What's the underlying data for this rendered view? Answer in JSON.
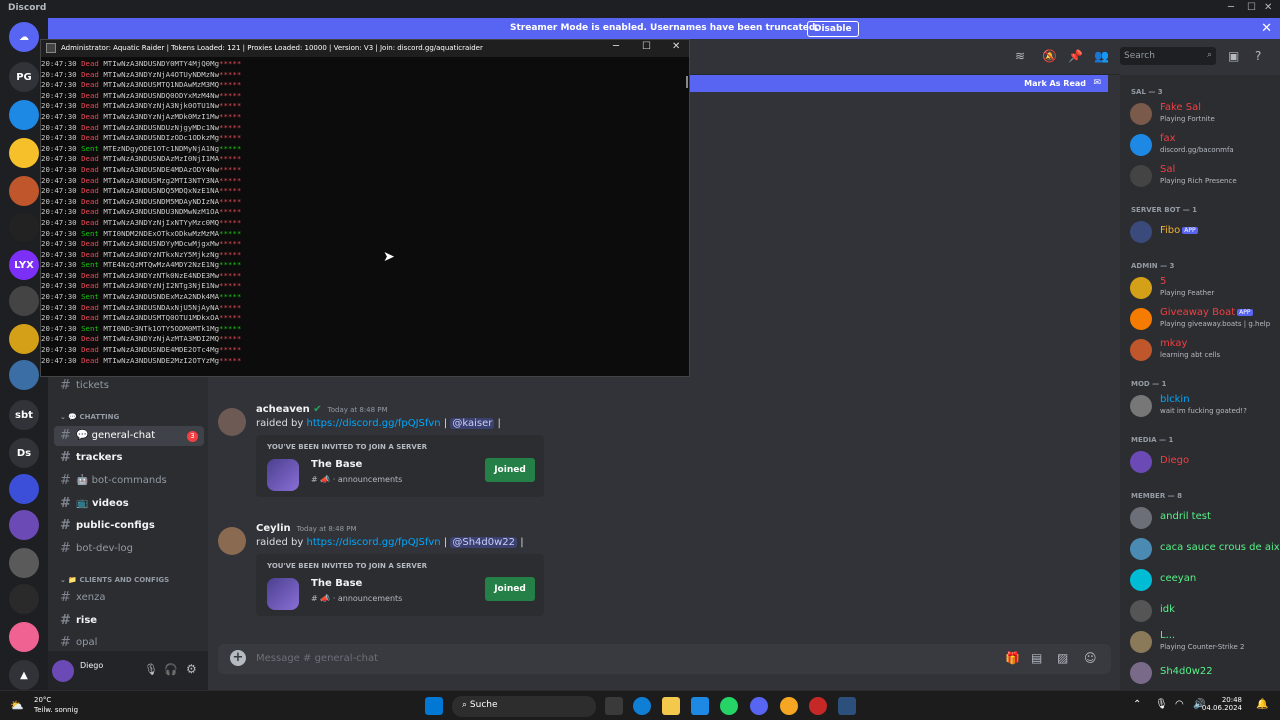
{
  "window": {
    "title": "Discord"
  },
  "banner": {
    "message": "Streamer Mode is enabled. Usernames have been truncated.",
    "disable_label": "Disable"
  },
  "rail": {
    "servers": [
      "PG",
      "sbt",
      "Ds",
      "LYX"
    ]
  },
  "console": {
    "title": "Administrator: Aquatic Raider   |   Tokens Loaded: 121   |   Proxies Loaded: 10000   |   Version: V3   |   Join: discord.gg/aquaticraider",
    "lines": [
      {
        "time": "20:47:30",
        "status": "Dead",
        "token": "MTIwNzA3NDUSNDY0MTY4MjQ0Mg"
      },
      {
        "time": "20:47:30",
        "status": "Dead",
        "token": "MTIwNzA3NDYzNjA4OTUyNDMzNw"
      },
      {
        "time": "20:47:30",
        "status": "Dead",
        "token": "MTIwNzA3NDUSMTQ1NDAwMzM3MQ"
      },
      {
        "time": "20:47:30",
        "status": "Dead",
        "token": "MTIwNzA3NDUSNDQ0ODYxMzM4Nw"
      },
      {
        "time": "20:47:30",
        "status": "Dead",
        "token": "MTIwNzA3NDYzNjA3Njk0OTU1Nw"
      },
      {
        "time": "20:47:30",
        "status": "Dead",
        "token": "MTIwNzA3NDYzNjAzMDk0MzI1Mw"
      },
      {
        "time": "20:47:30",
        "status": "Dead",
        "token": "MTIwNzA3NDUSNDUzNjgyMDc1Nw"
      },
      {
        "time": "20:47:30",
        "status": "Dead",
        "token": "MTIwNzA3NDUSNDIzODc1ODkzMg"
      },
      {
        "time": "20:47:30",
        "status": "Sent",
        "token": "MTEzNDgyODE1OTc1NDMyNjA1Ng"
      },
      {
        "time": "20:47:30",
        "status": "Dead",
        "token": "MTIwNzA3NDUSNDAzMzI0NjI1MA"
      },
      {
        "time": "20:47:30",
        "status": "Dead",
        "token": "MTIwNzA3NDUSNDE4MDAzODY4Nw"
      },
      {
        "time": "20:47:30",
        "status": "Dead",
        "token": "MTIwNzA3NDUSMzg2MTI3NTY3NA"
      },
      {
        "time": "20:47:30",
        "status": "Dead",
        "token": "MTIwNzA3NDUSNDQ5MDQxNzE1NA"
      },
      {
        "time": "20:47:30",
        "status": "Dead",
        "token": "MTIwNzA3NDUSNDM5MDAyNDIzNA"
      },
      {
        "time": "20:47:30",
        "status": "Dead",
        "token": "MTIwNzA3NDUSNDU3NDMwNzM1OA"
      },
      {
        "time": "20:47:30",
        "status": "Dead",
        "token": "MTIwNzA3NDYzNjIxNTYyMzc0MQ"
      },
      {
        "time": "20:47:30",
        "status": "Sent",
        "token": "MTI0NDM2NDExOTkxODkwMzMzMA"
      },
      {
        "time": "20:47:30",
        "status": "Dead",
        "token": "MTIwNzA3NDUSNDYyMDcwMjgxMw"
      },
      {
        "time": "20:47:30",
        "status": "Dead",
        "token": "MTIwNzA3NDYzNTkxNzY5MjkzNg"
      },
      {
        "time": "20:47:30",
        "status": "Sent",
        "token": "MTE4NzQzMTQwMzA4MDY2NzE1Ng"
      },
      {
        "time": "20:47:30",
        "status": "Dead",
        "token": "MTIwNzA3NDYzNTk0NzE4NDE3Mw"
      },
      {
        "time": "20:47:30",
        "status": "Dead",
        "token": "MTIwNzA3NDYzNjI2NTg3NjE1Nw"
      },
      {
        "time": "20:47:30",
        "status": "Sent",
        "token": "MTIwNzA3NDUSNDExMzA2NDk4MA"
      },
      {
        "time": "20:47:30",
        "status": "Dead",
        "token": "MTIwNzA3NDUSNDAxNjU5NjAyNA"
      },
      {
        "time": "20:47:30",
        "status": "Dead",
        "token": "MTIwNzA3NDUSMTQ0OTU1MDkxOA"
      },
      {
        "time": "20:47:30",
        "status": "Sent",
        "token": "MTI0NDc3NTk1OTY5ODM0MTk1Mg"
      },
      {
        "time": "20:47:30",
        "status": "Dead",
        "token": "MTIwNzA3NDYzNjAzMTA3MDI2MQ"
      },
      {
        "time": "20:47:30",
        "status": "Dead",
        "token": "MTIwNzA3NDUSNDE4MDE2OTc4Mg"
      },
      {
        "time": "20:47:30",
        "status": "Dead",
        "token": "MTIwNzA3NDUSNDE2MzI2OTYzMg"
      }
    ]
  },
  "channels": {
    "tickets": "tickets",
    "cat_chatting": "CHATTING",
    "general": "general-chat",
    "general_badge": "3",
    "trackers": "trackers",
    "bot_commands": "bot-commands",
    "videos": "videos",
    "public_configs": "public-configs",
    "bot_dev_log": "bot-dev-log",
    "cat_clients": "CLIENTS AND CONFIGS",
    "xenza": "xenza",
    "rise": "rise",
    "opal": "opal"
  },
  "user": {
    "name": "Diego"
  },
  "header": {
    "search_placeholder": "Search",
    "mark_read": "Mark As Read"
  },
  "messages": [
    {
      "author": "acheaven",
      "time": "Today at 8:48 PM",
      "prefix": "raided by ",
      "link": "https://discord.gg/fpQJSfvn",
      "sep": " | ",
      "mention": "@kaiser",
      "suffix": " |",
      "invite": {
        "label": "YOU'VE BEEN INVITED TO JOIN A SERVER",
        "server": "The Base",
        "channel": "announcements",
        "button": "Joined"
      }
    },
    {
      "author": "Ceylin",
      "time": "Today at 8:48 PM",
      "prefix": "raided by ",
      "link": "https://discord.gg/fpQJSfvn",
      "sep": " | ",
      "mention": "@Sh4d0w22",
      "suffix": " |",
      "invite": {
        "label": "YOU'VE BEEN INVITED TO JOIN A SERVER",
        "server": "The Base",
        "channel": "announcements",
        "button": "Joined"
      }
    }
  ],
  "composer": {
    "placeholder": "Message # general-chat"
  },
  "members": {
    "groups": [
      {
        "title": "SAL — 3",
        "items": [
          {
            "name": "Fake Sal",
            "status": "Playing Fortnite",
            "color": "#f23f43"
          },
          {
            "name": "fax",
            "status": "discord.gg/baconmfa",
            "color": "#f23f43"
          },
          {
            "name": "Sal",
            "status": "Playing Rich Presence",
            "color": "#f23f43"
          }
        ]
      },
      {
        "title": "SERVER BOT — 1",
        "items": [
          {
            "name": "Fibo",
            "status": "",
            "color": "#f0b232",
            "tag": "APP"
          }
        ]
      },
      {
        "title": "ADMIN — 3",
        "items": [
          {
            "name": "5",
            "status": "Playing Feather",
            "color": "#f23f43"
          },
          {
            "name": "Giveaway Boat",
            "status": "Playing giveaway.boats | g.help",
            "color": "#f23f43",
            "tag": "APP"
          },
          {
            "name": "mkay",
            "status": "learning abt cells",
            "color": "#f23f43"
          }
        ]
      },
      {
        "title": "MOD — 1",
        "items": [
          {
            "name": "blckin",
            "status": "wait im fucking goated!?",
            "color": "#00a8fc"
          }
        ]
      },
      {
        "title": "MEDIA — 1",
        "items": [
          {
            "name": "Diego",
            "status": "",
            "color": "#f23f43"
          }
        ]
      },
      {
        "title": "MEMBER — 8",
        "items": [
          {
            "name": "andril test",
            "status": "",
            "color": "#57f287"
          },
          {
            "name": "caca sauce crous de aix",
            "status": "",
            "color": "#57f287"
          },
          {
            "name": "ceeyan",
            "status": "",
            "color": "#57f287"
          },
          {
            "name": "idk",
            "status": "",
            "color": "#57f287"
          },
          {
            "name": "L...",
            "status": "Playing Counter-Strike 2",
            "color": "#57f287"
          },
          {
            "name": "Sh4d0w22",
            "status": "",
            "color": "#57f287"
          }
        ]
      }
    ]
  },
  "taskbar": {
    "weather_temp": "20°C",
    "weather_desc": "Teilw. sonnig",
    "search": "Suche",
    "time": "20:48",
    "date": "04.06.2024"
  }
}
